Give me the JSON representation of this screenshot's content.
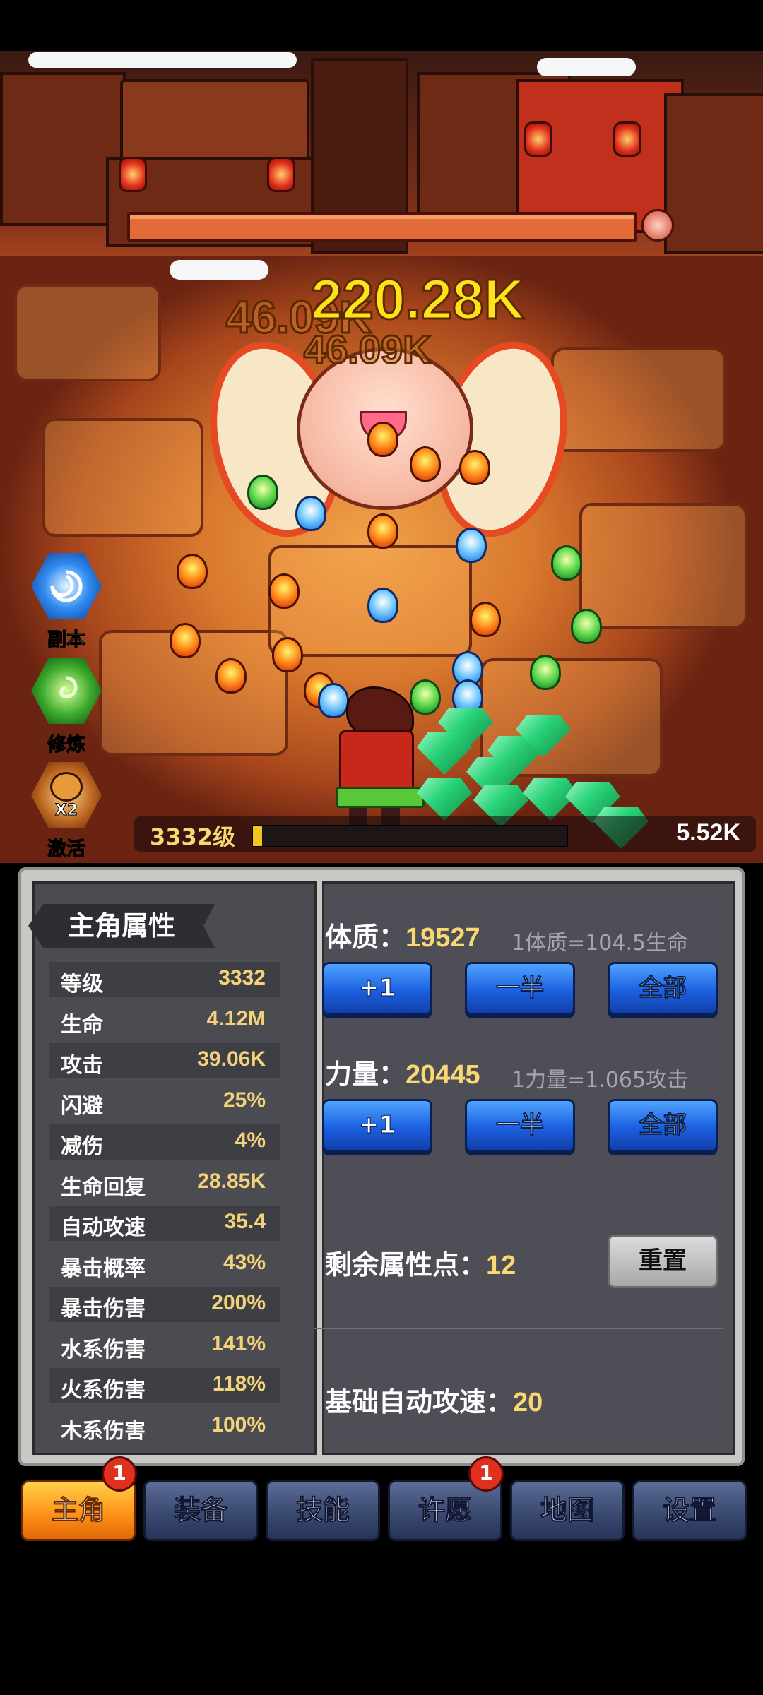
{
  "battle": {
    "damage_big": "220.28K",
    "damage_ghost_1": "46.09K",
    "damage_ghost_2": "46.09K"
  },
  "side_buttons": [
    {
      "label": "副本",
      "icon": "vortex-icon"
    },
    {
      "label": "修炼",
      "icon": "swirl-icon"
    },
    {
      "label": "激活",
      "icon": "potion-icon",
      "badge": "X2"
    }
  ],
  "player": {
    "level_text": "3332级",
    "exp_progress": 0.03,
    "resource_value": "5.52K"
  },
  "stats_panel": {
    "title": "主角属性",
    "rows": [
      {
        "name": "等级",
        "value": "3332"
      },
      {
        "name": "生命",
        "value": "4.12M"
      },
      {
        "name": "攻击",
        "value": "39.06K"
      },
      {
        "name": "闪避",
        "value": "25%"
      },
      {
        "name": "减伤",
        "value": "4%"
      },
      {
        "name": "生命回复",
        "value": "28.85K"
      },
      {
        "name": "自动攻速",
        "value": "35.4"
      },
      {
        "name": "暴击概率",
        "value": "43%"
      },
      {
        "name": "暴击伤害",
        "value": "200%"
      },
      {
        "name": "水系伤害",
        "value": "141%"
      },
      {
        "name": "火系伤害",
        "value": "118%"
      },
      {
        "name": "木系伤害",
        "value": "100%"
      }
    ]
  },
  "attributes": {
    "constitution": {
      "label": "体质：",
      "value": "19527",
      "hint": "1体质=104.5生命"
    },
    "strength": {
      "label": "力量：",
      "value": "20445",
      "hint": "1力量=1.065攻击"
    },
    "buttons": {
      "plus_one": "+1",
      "half": "一半",
      "all": "全部"
    },
    "remaining": {
      "label": "剩余属性点：",
      "value": "12"
    },
    "reset_label": "重置",
    "base_speed": {
      "label": "基础自动攻速：",
      "value": "20"
    }
  },
  "tabs": [
    {
      "label": "主角",
      "active": true,
      "badge": "1"
    },
    {
      "label": "装备"
    },
    {
      "label": "技能"
    },
    {
      "label": "许愿",
      "badge": "1"
    },
    {
      "label": "地图"
    },
    {
      "label": "设置"
    }
  ],
  "colors": {
    "accent_gold": "#f9d772",
    "button_blue": "#1b5fe0",
    "tab_active": "#ff9418",
    "hp_bar": "#e36b3a",
    "exp_bar": "#f4c320"
  }
}
